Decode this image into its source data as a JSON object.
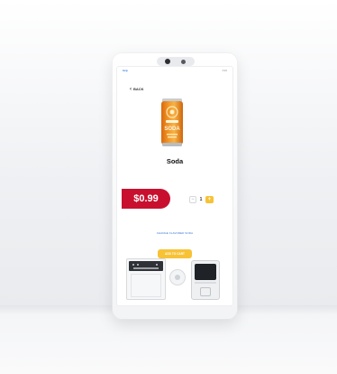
{
  "status_bar": {
    "brand": "lorp",
    "code": "K10"
  },
  "navigation": {
    "back_label": "BACK"
  },
  "product": {
    "name": "Soda",
    "price": "$0.99",
    "quantity": "1",
    "can_label": "SODA"
  },
  "quantity_controls": {
    "minus_symbol": "−",
    "plus_symbol": "+"
  },
  "links": {
    "change_flavor": "CHANGE FLAVORED SODA"
  },
  "actions": {
    "add_to_cart": "ADD TO CART"
  },
  "icons": [
    "chevron-left-icon",
    "soda-can-icon",
    "minus-icon",
    "plus-icon",
    "printer-icon",
    "nfc-reader-icon",
    "card-terminal-icon"
  ],
  "colors": {
    "price_badge": "#c8102e",
    "accent": "#f7c236",
    "link": "#2a6bd4",
    "can": "#f08a1a"
  }
}
